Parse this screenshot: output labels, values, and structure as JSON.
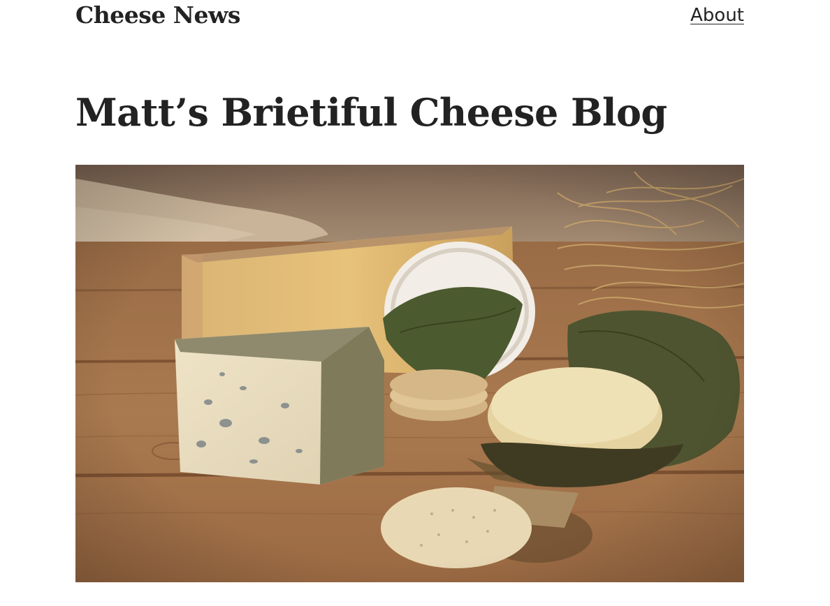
{
  "header": {
    "site_title": "Cheese News",
    "nav": {
      "about_label": "About"
    }
  },
  "post": {
    "title": "Matt’s Brietiful Cheese Blog"
  },
  "hero_image": {
    "icon": "cheese-photo"
  },
  "colors": {
    "text": "#222222",
    "background": "#ffffff",
    "wood": "#a06f48",
    "backdrop": "#9c8066"
  }
}
